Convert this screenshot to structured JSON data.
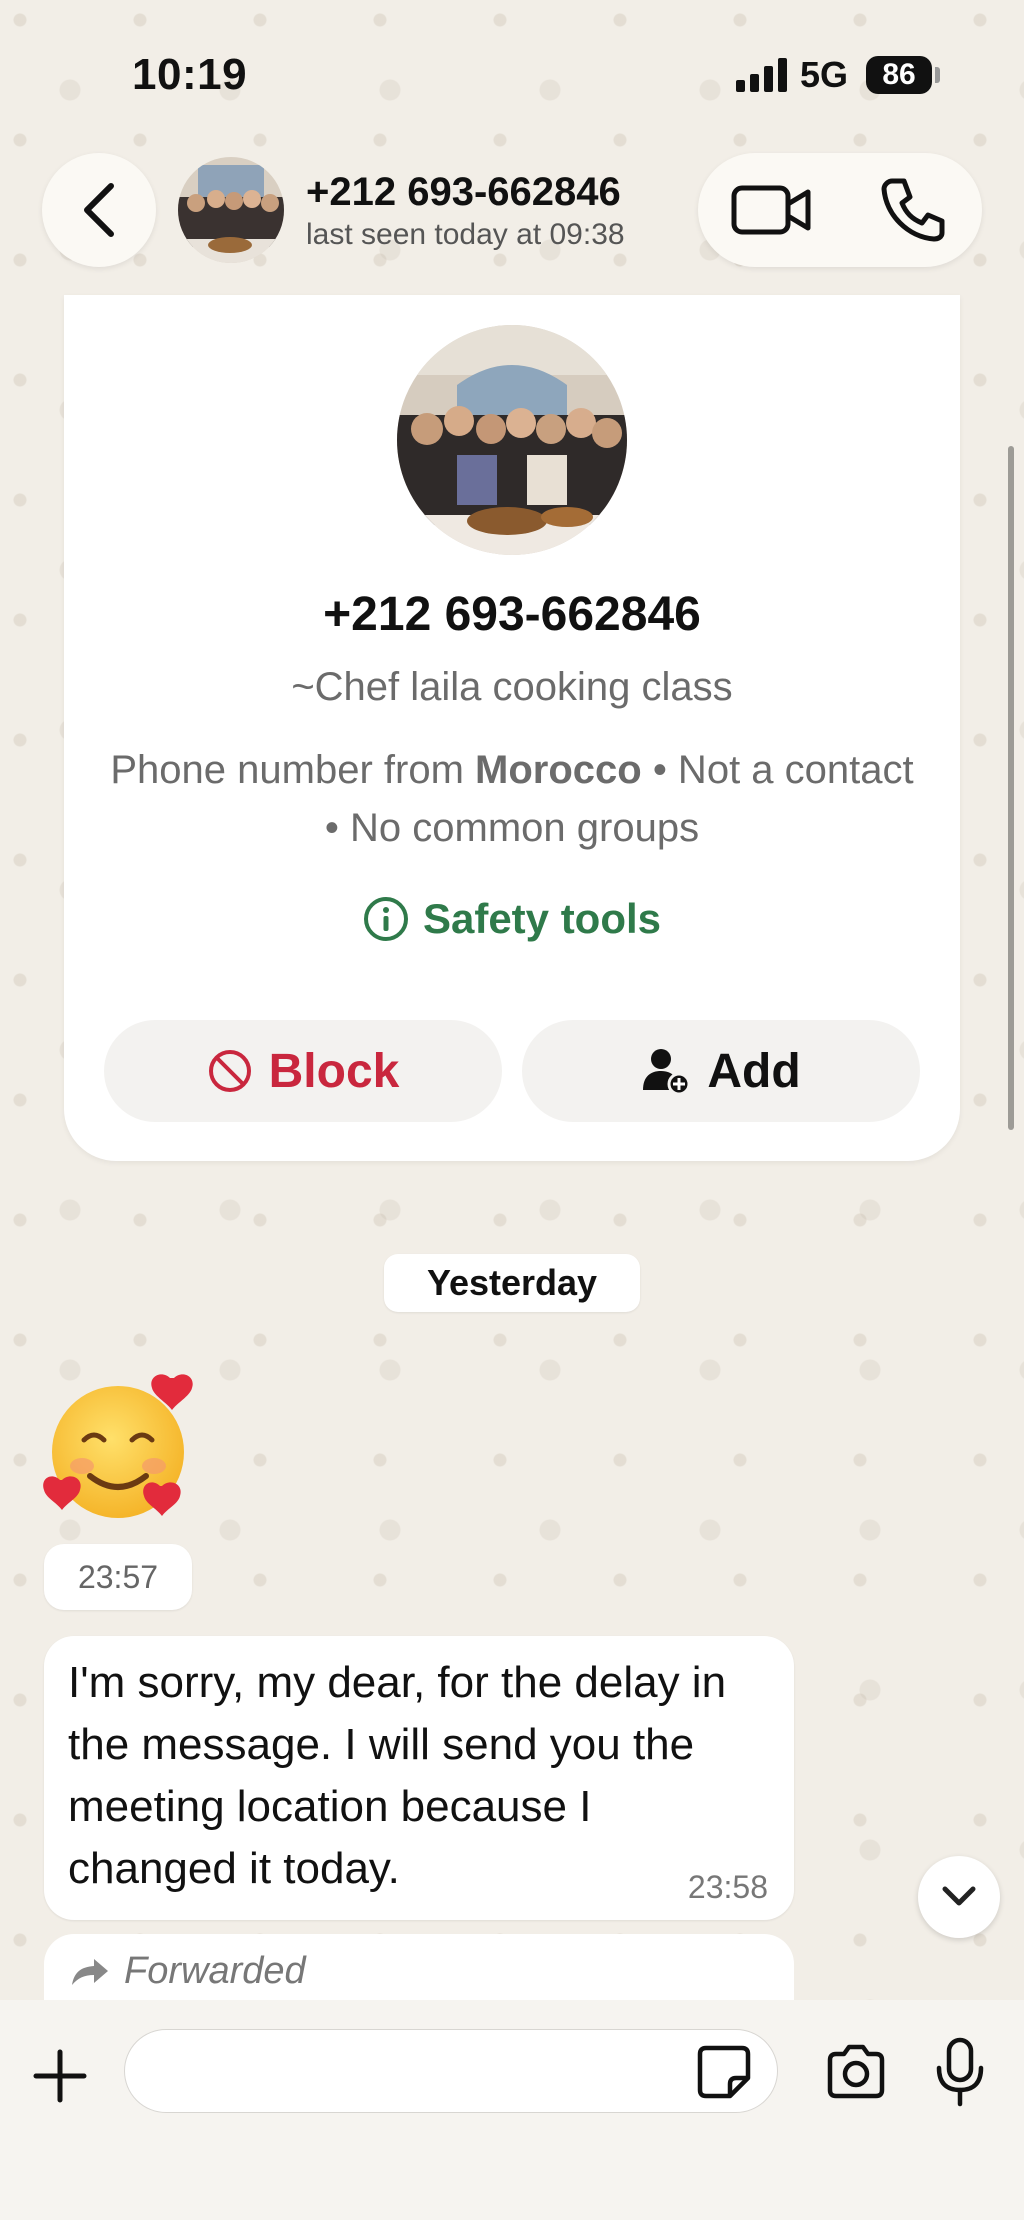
{
  "status_bar": {
    "time": "10:19",
    "network": "5G",
    "battery": "86"
  },
  "header": {
    "name": "+212 693-662846",
    "subtitle": "last seen today at 09:38"
  },
  "info_card": {
    "phone": "+212 693-662846",
    "push_name": "~Chef laila cooking class",
    "meta_prefix": "Phone number from ",
    "meta_country": "Morocco",
    "meta_suffix": " • Not a contact • No common groups",
    "safety_tools": "Safety tools",
    "block_label": "Block",
    "add_label": "Add"
  },
  "messages": {
    "date_chip": "Yesterday",
    "emoji_time": "23:57",
    "text": "I'm sorry, my dear, for the delay in the message. I will send you the meeting location because I changed it today.",
    "text_time": "23:58",
    "forwarded_label": "Forwarded"
  },
  "composer": {
    "placeholder": ""
  },
  "colors": {
    "wallpaper": "#f2eee7",
    "safety_green": "#2f7a4a",
    "block_red": "#c9273e"
  },
  "icons": {
    "back": "chevron-left-icon",
    "video": "video-camera-icon",
    "phone": "phone-icon",
    "info": "info-circle-icon",
    "block": "block-icon",
    "add_contact": "add-person-icon",
    "forward": "forward-arrow-icon",
    "scroll_down": "chevron-down-icon",
    "plus": "plus-icon",
    "sticker": "sticker-icon",
    "camera": "camera-icon",
    "mic": "microphone-icon"
  }
}
